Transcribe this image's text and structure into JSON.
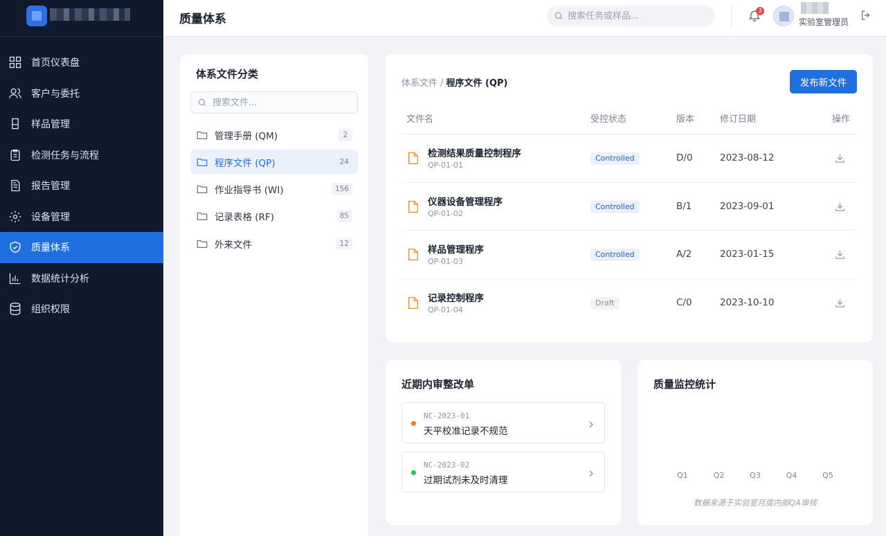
{
  "sidebar": {
    "items": [
      {
        "label": "首页仪表盘",
        "icon": "dashboard-icon"
      },
      {
        "label": "客户与委托",
        "icon": "users-icon"
      },
      {
        "label": "样品管理",
        "icon": "beaker-icon"
      },
      {
        "label": "检测任务与流程",
        "icon": "clipboard-icon"
      },
      {
        "label": "报告管理",
        "icon": "report-icon"
      },
      {
        "label": "设备管理",
        "icon": "gear-icon"
      },
      {
        "label": "质量体系",
        "icon": "shield-icon",
        "active": true
      },
      {
        "label": "数据统计分析",
        "icon": "bar-chart-icon"
      },
      {
        "label": "组织权限",
        "icon": "database-icon"
      }
    ]
  },
  "header": {
    "title": "质量体系",
    "search_placeholder": "搜索任务或样品...",
    "notification_count": "3",
    "user_role": "实验室管理员"
  },
  "categories": {
    "title": "体系文件分类",
    "search_placeholder": "搜索文件...",
    "items": [
      {
        "label": "管理手册 (QM)",
        "count": "2"
      },
      {
        "label": "程序文件 (QP)",
        "count": "24",
        "active": true
      },
      {
        "label": "作业指导书 (WI)",
        "count": "156"
      },
      {
        "label": "记录表格 (RF)",
        "count": "85"
      },
      {
        "label": "外来文件",
        "count": "12"
      }
    ]
  },
  "documents": {
    "breadcrumb_root": "体系文件 /",
    "breadcrumb_current": "程序文件 (QP)",
    "publish_label": "发布新文件",
    "columns": [
      "文件名",
      "受控状态",
      "版本",
      "修订日期",
      "操作"
    ],
    "rows": [
      {
        "name": "检测结果质量控制程序",
        "code": "QP-01-01",
        "status": "Controlled",
        "status_type": "ctrl",
        "version": "D/0",
        "date": "2023-08-12"
      },
      {
        "name": "仪器设备管理程序",
        "code": "QP-01-02",
        "status": "Controlled",
        "status_type": "ctrl",
        "version": "B/1",
        "date": "2023-09-01"
      },
      {
        "name": "样品管理程序",
        "code": "QP-01-03",
        "status": "Controlled",
        "status_type": "ctrl",
        "version": "A/2",
        "date": "2023-01-15"
      },
      {
        "name": "记录控制程序",
        "code": "QP-01-04",
        "status": "Draft",
        "status_type": "draft",
        "version": "C/0",
        "date": "2023-10-10"
      }
    ]
  },
  "nonconformities": {
    "title": "近期内审整改单",
    "items": [
      {
        "code": "NC-2023-01",
        "text": "天平校准记录不规范",
        "dot_color": "#f07a24"
      },
      {
        "code": "NC-2023-02",
        "text": "过期试剂未及时清理",
        "dot_color": "#22c55e"
      }
    ]
  },
  "quality_stats": {
    "title": "质量监控统计",
    "note": "数据来源于实验室月度内部QA审核",
    "chart_data": {
      "type": "bar",
      "categories": [
        "Q1",
        "Q2",
        "Q3",
        "Q4",
        "Q5"
      ]
    }
  }
}
